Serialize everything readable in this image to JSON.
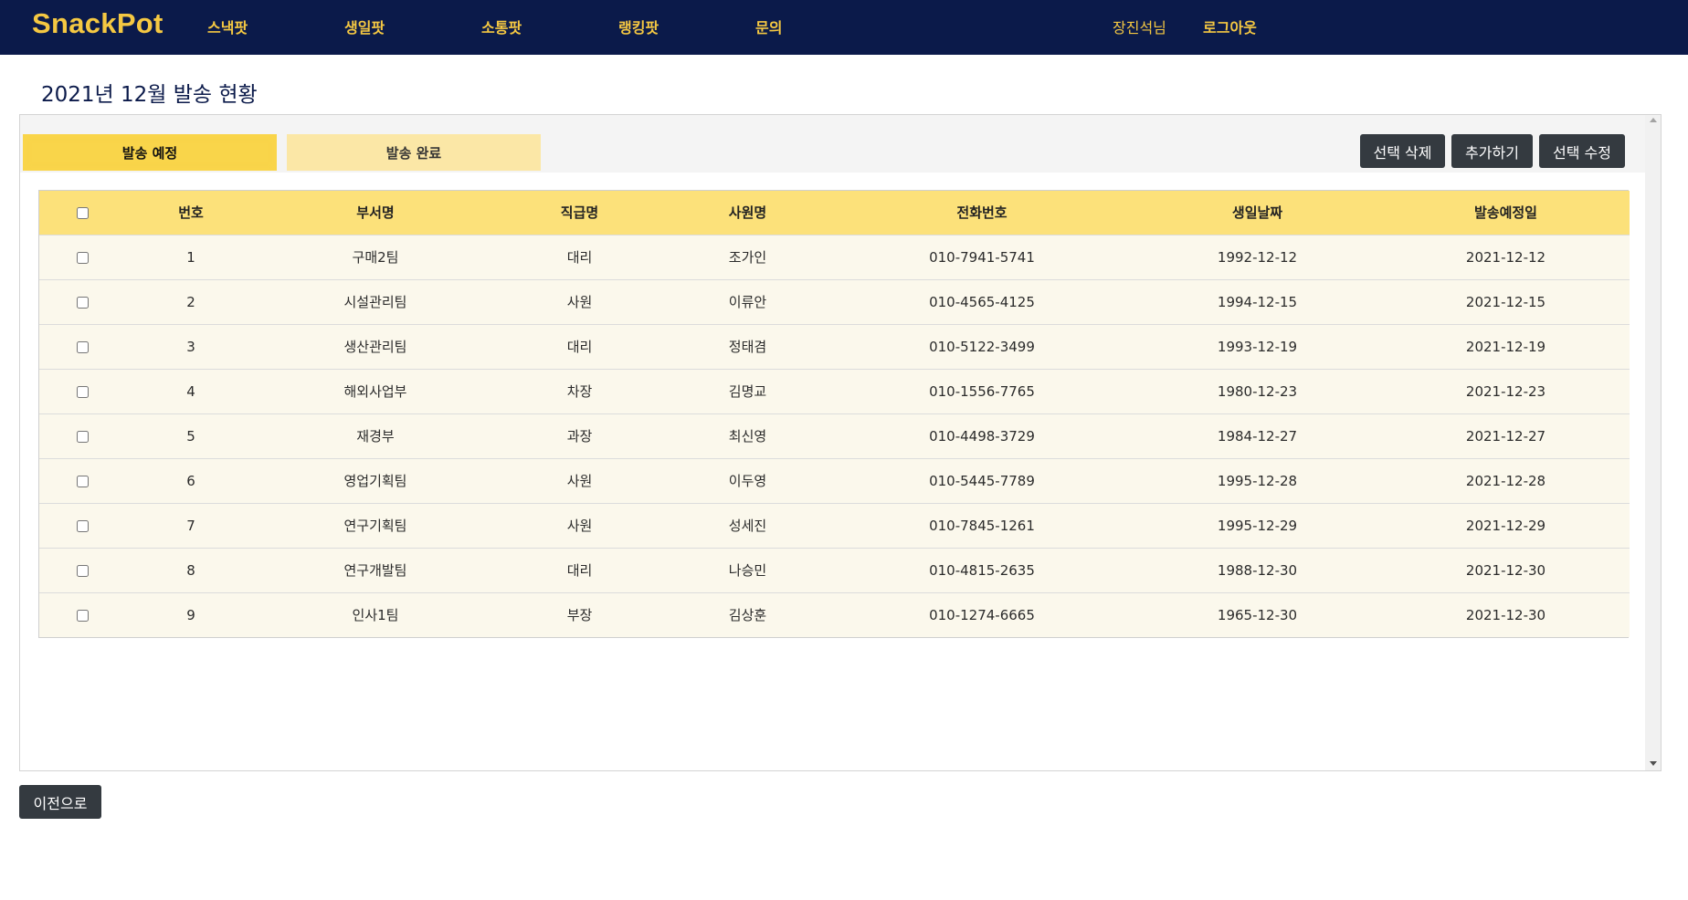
{
  "nav": {
    "brand": "SnackPot",
    "links": [
      "스낵팟",
      "생일팟",
      "소통팟",
      "랭킹팟",
      "문의"
    ],
    "user": "장진석님",
    "logout": "로그아웃"
  },
  "page": {
    "title": "2021년 12월 발송 현황"
  },
  "tabs": [
    "발송 예정",
    "발송 완료"
  ],
  "actions": {
    "delete": "선택 삭제",
    "add": "추가하기",
    "edit": "선택 수정"
  },
  "table": {
    "headers": [
      "번호",
      "부서명",
      "직급명",
      "사원명",
      "전화번호",
      "생일날짜",
      "발송예정일"
    ],
    "rows": [
      [
        "1",
        "구매2팀",
        "대리",
        "조가인",
        "010-7941-5741",
        "1992-12-12",
        "2021-12-12"
      ],
      [
        "2",
        "시설관리팀",
        "사원",
        "이류안",
        "010-4565-4125",
        "1994-12-15",
        "2021-12-15"
      ],
      [
        "3",
        "생산관리팀",
        "대리",
        "정태겸",
        "010-5122-3499",
        "1993-12-19",
        "2021-12-19"
      ],
      [
        "4",
        "해외사업부",
        "차장",
        "김명교",
        "010-1556-7765",
        "1980-12-23",
        "2021-12-23"
      ],
      [
        "5",
        "재경부",
        "과장",
        "최신영",
        "010-4498-3729",
        "1984-12-27",
        "2021-12-27"
      ],
      [
        "6",
        "영업기획팀",
        "사원",
        "이두영",
        "010-5445-7789",
        "1995-12-28",
        "2021-12-28"
      ],
      [
        "7",
        "연구기획팀",
        "사원",
        "성세진",
        "010-7845-1261",
        "1995-12-29",
        "2021-12-29"
      ],
      [
        "8",
        "연구개발팀",
        "대리",
        "나승민",
        "010-4815-2635",
        "1988-12-30",
        "2021-12-30"
      ],
      [
        "9",
        "인사1팀",
        "부장",
        "김상훈",
        "010-1274-6665",
        "1965-12-30",
        "2021-12-30"
      ]
    ]
  },
  "footer": {
    "back": "이전으로"
  },
  "colors": {
    "navbar": "#0b1a4a",
    "accent": "#f5c842",
    "tab_active": "#f9d54a",
    "tab_inactive": "#fbe7a6",
    "table_header": "#fce17a",
    "row_bg": "#fbf8ec",
    "button": "#343a40"
  }
}
